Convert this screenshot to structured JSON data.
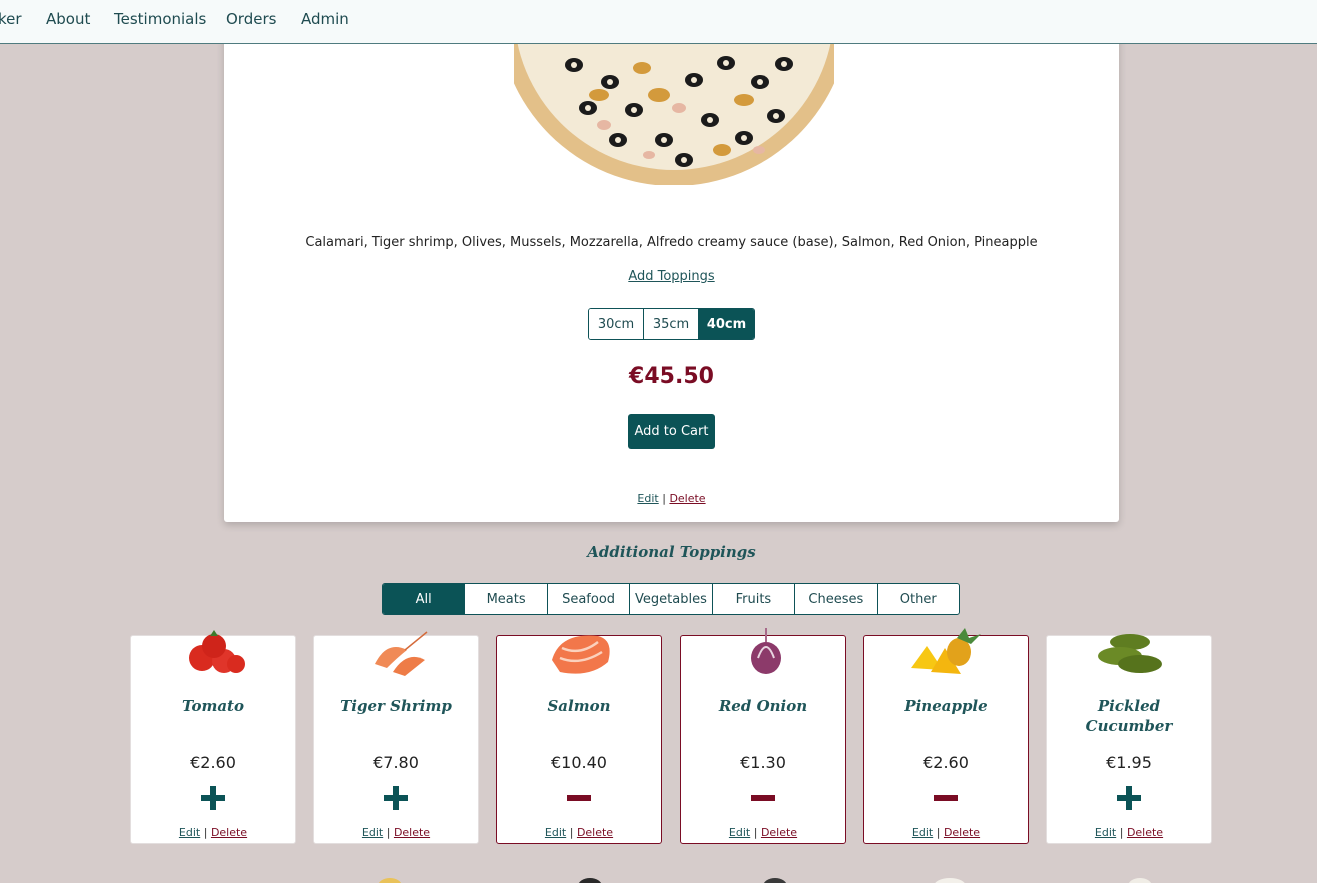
{
  "nav": {
    "items": [
      "ker",
      "About",
      "Testimonials",
      "Orders",
      "Admin"
    ]
  },
  "product": {
    "ingredients": "Calamari, Tiger shrimp, Olives, Mussels, Mozzarella, Alfredo creamy sauce (base), Salmon, Red Onion, Pineapple",
    "add_toppings_label": "Add Toppings",
    "sizes": [
      "30cm",
      "35cm",
      "40cm"
    ],
    "selected_size": "40cm",
    "price": "€45.50",
    "add_to_cart_label": "Add to Cart",
    "edit_label": "Edit",
    "separator": "|",
    "delete_label": "Delete"
  },
  "toppings_section": {
    "title": "Additional Toppings",
    "filters": [
      "All",
      "Meats",
      "Seafood",
      "Vegetables",
      "Fruits",
      "Cheeses",
      "Other"
    ],
    "active_filter": "All",
    "cards": [
      {
        "name": "Tomato",
        "price": "€2.60",
        "action": "add",
        "selected": false,
        "image": "tomato-image"
      },
      {
        "name": "Tiger Shrimp",
        "price": "€7.80",
        "action": "add",
        "selected": false,
        "image": "shrimp-image"
      },
      {
        "name": "Salmon",
        "price": "€10.40",
        "action": "remove",
        "selected": true,
        "image": "salmon-image"
      },
      {
        "name": "Red Onion",
        "price": "€1.30",
        "action": "remove",
        "selected": true,
        "image": "red-onion-image"
      },
      {
        "name": "Pineapple",
        "price": "€2.60",
        "action": "remove",
        "selected": true,
        "image": "pineapple-image"
      },
      {
        "name": "Pickled Cucumber",
        "price": "€1.95",
        "action": "add",
        "selected": false,
        "image": "pickles-image"
      }
    ],
    "edit_label": "Edit",
    "separator": "|",
    "delete_label": "Delete"
  },
  "colors": {
    "primary": "#0b5356",
    "accent": "#7a0c24",
    "background": "#d6cccb"
  }
}
